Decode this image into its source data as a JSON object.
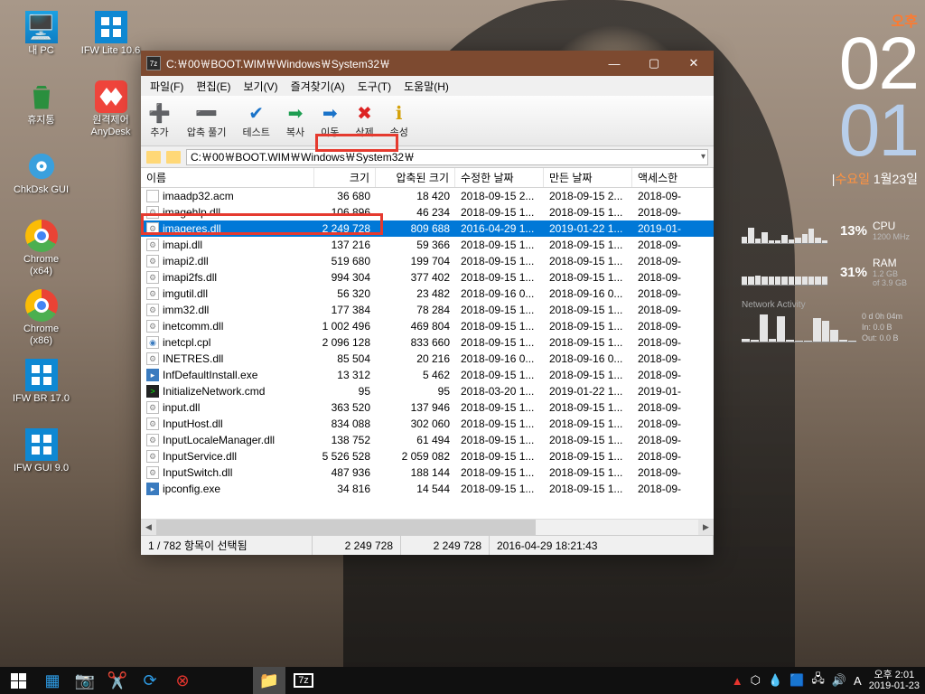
{
  "desktop": {
    "icons": [
      {
        "label": "내 PC",
        "cls": "ic-pc"
      },
      {
        "label": "IFW Lite 10.6",
        "cls": "ic-ifw"
      },
      {
        "label": "휴지통",
        "cls": "ic-trash"
      },
      {
        "label": "원격제어\nAnyDesk",
        "cls": "ic-anydesk"
      },
      {
        "label": "ChkDsk GUI",
        "cls": "ic-chkdsk"
      },
      {
        "label": "",
        "cls": ""
      },
      {
        "label": "Chrome\n(x64)",
        "cls": "ic-chrome"
      },
      {
        "label": "",
        "cls": ""
      },
      {
        "label": "Chrome\n(x86)",
        "cls": "ic-chrome"
      },
      {
        "label": "",
        "cls": ""
      },
      {
        "label": "IFW BR 17.0",
        "cls": "ic-ifwbr"
      },
      {
        "label": "",
        "cls": ""
      },
      {
        "label": "IFW GUI 9.0",
        "cls": "ic-ifwgui"
      }
    ]
  },
  "clock": {
    "ampm": "오후",
    "hh": "02",
    "mm": "01",
    "day": "수요일",
    "date": "1월23일"
  },
  "hw": {
    "cpu": {
      "pct": "13%",
      "lab": "CPU",
      "sub": "1200 MHz"
    },
    "ram": {
      "pct": "31%",
      "lab": "RAM",
      "sub": "1.2 GB\nof 3.9 GB"
    },
    "net": {
      "title": "Network Activity",
      "uptime": "0 d 0h 04m",
      "in": "In: 0.0 B",
      "out": "Out: 0.0 B"
    }
  },
  "window": {
    "title": "C:￦00￦BOOT.WIM￦Windows￦System32￦",
    "menu": [
      "파일(F)",
      "편집(E)",
      "보기(V)",
      "즐겨찾기(A)",
      "도구(T)",
      "도움말(H)"
    ],
    "toolbar": [
      {
        "icon": "➕",
        "color": "#29a329",
        "label": "추가"
      },
      {
        "icon": "➖",
        "color": "#b33",
        "label": "압축 풀기"
      },
      {
        "icon": "✔",
        "color": "#1a73c9",
        "label": "테스트"
      },
      {
        "icon": "➡",
        "color": "#1e9e52",
        "label": "복사"
      },
      {
        "icon": "➡",
        "color": "#1a73c9",
        "label": "이동"
      },
      {
        "icon": "✖",
        "color": "#d22",
        "label": "삭제"
      },
      {
        "icon": "ℹ",
        "color": "#d4a10a",
        "label": "속성"
      }
    ],
    "path": "C:￦00￦BOOT.WIM￦Windows￦System32￦",
    "columns": {
      "name": "이름",
      "size": "크기",
      "psize": "압축된 크기",
      "mdate": "수정한 날짜",
      "cdate": "만든 날짜",
      "adate": "액세스한"
    },
    "rows": [
      {
        "ic": "acm",
        "name": "imaadp32.acm",
        "size": "36 680",
        "psize": "18 420",
        "m": "2018-09-15 2...",
        "c": "2018-09-15 2...",
        "a": "2018-09-"
      },
      {
        "ic": "dll",
        "name": "imagehlp.dll",
        "size": "106 896",
        "psize": "46 234",
        "m": "2018-09-15 1...",
        "c": "2018-09-15 1...",
        "a": "2018-09-"
      },
      {
        "ic": "dll",
        "name": "imageres.dll",
        "size": "2 249 728",
        "psize": "809 688",
        "m": "2016-04-29 1...",
        "c": "2019-01-22 1...",
        "a": "2019-01-",
        "sel": true
      },
      {
        "ic": "dll",
        "name": "imapi.dll",
        "size": "137 216",
        "psize": "59 366",
        "m": "2018-09-15 1...",
        "c": "2018-09-15 1...",
        "a": "2018-09-"
      },
      {
        "ic": "dll",
        "name": "imapi2.dll",
        "size": "519 680",
        "psize": "199 704",
        "m": "2018-09-15 1...",
        "c": "2018-09-15 1...",
        "a": "2018-09-"
      },
      {
        "ic": "dll",
        "name": "imapi2fs.dll",
        "size": "994 304",
        "psize": "377 402",
        "m": "2018-09-15 1...",
        "c": "2018-09-15 1...",
        "a": "2018-09-"
      },
      {
        "ic": "dll",
        "name": "imgutil.dll",
        "size": "56 320",
        "psize": "23 482",
        "m": "2018-09-16 0...",
        "c": "2018-09-16 0...",
        "a": "2018-09-"
      },
      {
        "ic": "dll",
        "name": "imm32.dll",
        "size": "177 384",
        "psize": "78 284",
        "m": "2018-09-15 1...",
        "c": "2018-09-15 1...",
        "a": "2018-09-"
      },
      {
        "ic": "dll",
        "name": "inetcomm.dll",
        "size": "1 002 496",
        "psize": "469 804",
        "m": "2018-09-15 1...",
        "c": "2018-09-15 1...",
        "a": "2018-09-"
      },
      {
        "ic": "cpl",
        "name": "inetcpl.cpl",
        "size": "2 096 128",
        "psize": "833 660",
        "m": "2018-09-15 1...",
        "c": "2018-09-15 1...",
        "a": "2018-09-"
      },
      {
        "ic": "dll",
        "name": "INETRES.dll",
        "size": "85 504",
        "psize": "20 216",
        "m": "2018-09-16 0...",
        "c": "2018-09-16 0...",
        "a": "2018-09-"
      },
      {
        "ic": "exe",
        "name": "InfDefaultInstall.exe",
        "size": "13 312",
        "psize": "5 462",
        "m": "2018-09-15 1...",
        "c": "2018-09-15 1...",
        "a": "2018-09-"
      },
      {
        "ic": "cmd",
        "name": "InitializeNetwork.cmd",
        "size": "95",
        "psize": "95",
        "m": "2018-03-20 1...",
        "c": "2019-01-22 1...",
        "a": "2019-01-"
      },
      {
        "ic": "dll",
        "name": "input.dll",
        "size": "363 520",
        "psize": "137 946",
        "m": "2018-09-15 1...",
        "c": "2018-09-15 1...",
        "a": "2018-09-"
      },
      {
        "ic": "dll",
        "name": "InputHost.dll",
        "size": "834 088",
        "psize": "302 060",
        "m": "2018-09-15 1...",
        "c": "2018-09-15 1...",
        "a": "2018-09-"
      },
      {
        "ic": "dll",
        "name": "InputLocaleManager.dll",
        "size": "138 752",
        "psize": "61 494",
        "m": "2018-09-15 1...",
        "c": "2018-09-15 1...",
        "a": "2018-09-"
      },
      {
        "ic": "dll",
        "name": "InputService.dll",
        "size": "5 526 528",
        "psize": "2 059 082",
        "m": "2018-09-15 1...",
        "c": "2018-09-15 1...",
        "a": "2018-09-"
      },
      {
        "ic": "dll",
        "name": "InputSwitch.dll",
        "size": "487 936",
        "psize": "188 144",
        "m": "2018-09-15 1...",
        "c": "2018-09-15 1...",
        "a": "2018-09-"
      },
      {
        "ic": "exe",
        "name": "ipconfig.exe",
        "size": "34 816",
        "psize": "14 544",
        "m": "2018-09-15 1...",
        "c": "2018-09-15 1...",
        "a": "2018-09-"
      }
    ],
    "status": {
      "sel": "1 / 782 항목이 선택됨",
      "s1": "2 249 728",
      "s2": "2 249 728",
      "s3": "2016-04-29 18:21:43"
    }
  },
  "taskbar": {
    "tray_time": "오후 2:01",
    "tray_date": "2019-01-23"
  }
}
